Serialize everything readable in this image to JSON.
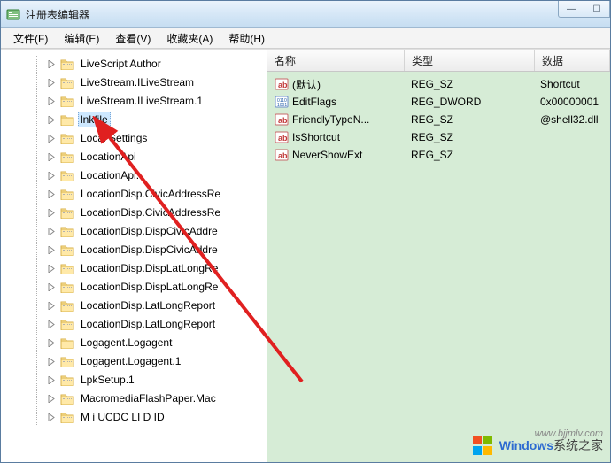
{
  "window": {
    "title": "注册表编辑器"
  },
  "menu": {
    "file": "文件(F)",
    "edit": "编辑(E)",
    "view": "查看(V)",
    "favorites": "收藏夹(A)",
    "help": "帮助(H)"
  },
  "tree": {
    "items": [
      {
        "label": "LiveScript Author"
      },
      {
        "label": "LiveStream.ILiveStream"
      },
      {
        "label": "LiveStream.ILiveStream.1"
      },
      {
        "label": "lnkfile",
        "selected": true
      },
      {
        "label": "Local Settings"
      },
      {
        "label": "LocationApi"
      },
      {
        "label": "LocationApi."
      },
      {
        "label": "LocationDisp.CivicAddressRe"
      },
      {
        "label": "LocationDisp.CivicAddressRe"
      },
      {
        "label": "LocationDisp.DispCivicAddre"
      },
      {
        "label": "LocationDisp.DispCivicAddre"
      },
      {
        "label": "LocationDisp.DispLatLongRe"
      },
      {
        "label": "LocationDisp.DispLatLongRe"
      },
      {
        "label": "LocationDisp.LatLongReport"
      },
      {
        "label": "LocationDisp.LatLongReport"
      },
      {
        "label": "Logagent.Logagent"
      },
      {
        "label": "Logagent.Logagent.1"
      },
      {
        "label": "LpkSetup.1"
      },
      {
        "label": "MacromediaFlashPaper.Mac"
      },
      {
        "label": "M    i UCDC  LI  D   ID"
      }
    ]
  },
  "columns": {
    "name": "名称",
    "type": "类型",
    "data": "数据"
  },
  "rows": [
    {
      "icon": "string",
      "name": "(默认)",
      "type": "REG_SZ",
      "data": "Shortcut"
    },
    {
      "icon": "binary",
      "name": "EditFlags",
      "type": "REG_DWORD",
      "data": "0x00000001"
    },
    {
      "icon": "string",
      "name": "FriendlyTypeN...",
      "type": "REG_SZ",
      "data": "@shell32.dll"
    },
    {
      "icon": "string",
      "name": "IsShortcut",
      "type": "REG_SZ",
      "data": ""
    },
    {
      "icon": "string",
      "name": "NeverShowExt",
      "type": "REG_SZ",
      "data": ""
    }
  ],
  "watermark": {
    "brand": "Windows",
    "suffix": "系统之家",
    "url": "www.bjjmlv.com"
  }
}
